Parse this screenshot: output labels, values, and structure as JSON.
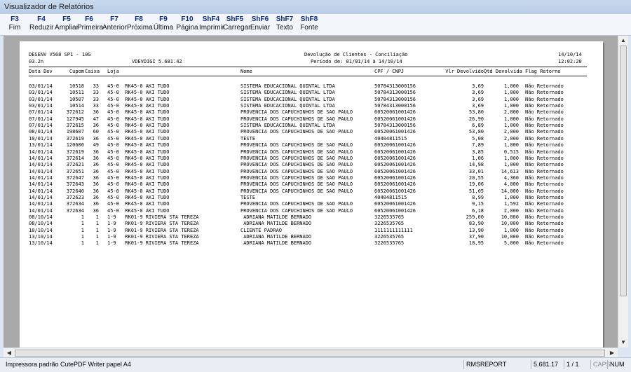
{
  "window": {
    "title": "Visualizador de Relatórios"
  },
  "toolbar": [
    {
      "key": "F3",
      "label": "Fim"
    },
    {
      "key": "F4",
      "label": "Reduzir"
    },
    {
      "key": "F5",
      "label": "Ampliar"
    },
    {
      "key": "F6",
      "label": "Primeira"
    },
    {
      "key": "F7",
      "label": "Anterior"
    },
    {
      "key": "F8",
      "label": "Próxima"
    },
    {
      "key": "F9",
      "label": "Última"
    },
    {
      "key": "F10",
      "label": "Página"
    },
    {
      "key": "ShF4",
      "label": "Imprimir"
    },
    {
      "key": "ShF5",
      "label": "Carregar"
    },
    {
      "key": "ShF6",
      "label": "Enviar"
    },
    {
      "key": "ShF7",
      "label": "Texto"
    },
    {
      "key": "ShF8",
      "label": "Fonte"
    }
  ],
  "report": {
    "system": "DESENV V568 SP1 - 10G",
    "version": "03.2n",
    "program": "VDEVDIGI 5.681.42",
    "title": "Devolução de Clientes - Conciliação",
    "period": "Período de: 01/01/14 à 14/10/14",
    "date": "14/10/14",
    "time": "12:02:20",
    "columns": [
      "Data Dev",
      "Cupom",
      "Caixa",
      "Loja",
      "Nome",
      "CPF / CNPJ",
      "Vlr Devolvido",
      "Qtd Devolvida",
      "Flag Retorno"
    ],
    "rows": [
      [
        "03/01/14",
        "10518",
        "33",
        "45-0  RK45-0 AKI TUDO",
        "SISTEMA EDUCACIONAL QUINTAL LTDA",
        "50784313000156",
        "3,69",
        "1,000",
        "Não Retornado"
      ],
      [
        "03/01/14",
        "10511",
        "33",
        "45-0  RK45-0 AKI TUDO",
        "SISTEMA EDUCACIONAL QUINTAL LTDA",
        "50784313000156",
        "3,69",
        "1,000",
        "Não Retornado"
      ],
      [
        "03/01/14",
        "10507",
        "33",
        "45-0  RK45-0 AKI TUDO",
        "SISTEMA EDUCACIONAL QUINTAL LTDA",
        "50784313000156",
        "3,69",
        "1,000",
        "Não Retornado"
      ],
      [
        "03/01/14",
        "10514",
        "33",
        "45-0  RK45-0 AKI TUDO",
        "SISTEMA EDUCACIONAL QUINTAL LTDA",
        "50784313000156",
        "3,69",
        "1,000",
        "Não Retornado"
      ],
      [
        "07/01/14",
        "372612",
        "36",
        "45-0  RK45-0 AKI TUDO",
        "PROVENCIA DOS CAPUCHINHOS DE SAO PAULO",
        "60520061001426",
        "53,80",
        "2,000",
        "Não Retornado"
      ],
      [
        "07/01/14",
        "127945",
        "47",
        "45-0  RK45-0 AKI TUDO",
        "PROVENCIA DOS CAPUCHINHOS DE SAO PAULO",
        "60520061001426",
        "26,90",
        "1,000",
        "Não Retornado"
      ],
      [
        "07/01/14",
        "372615",
        "36",
        "45-0  RK45-0 AKI TUDO",
        "SISTEMA EDUCACIONAL QUINTAL LTDA",
        "50784313000156",
        "6,89",
        "1,000",
        "Não Retornado"
      ],
      [
        "08/01/14",
        "198607",
        "60",
        "45-0  RK45-0 AKI TUDO",
        "PROVENCIA DOS CAPUCHINHOS DE SAO PAULO",
        "60520061001426",
        "53,80",
        "2,000",
        "Não Retornado"
      ],
      [
        "10/01/14",
        "372619",
        "36",
        "45-0  RK45-0 AKI TUDO",
        "TESTE",
        "40404811515",
        "5,08",
        "2,000",
        "Não Retornado"
      ],
      [
        "13/01/14",
        "120606",
        "49",
        "45-0  RK45-0 AKI TUDO",
        "PROVENCIA DOS CAPUCHINHOS DE SAO PAULO",
        "60520061001426",
        "7,89",
        "1,000",
        "Não Retornado"
      ],
      [
        "14/01/14",
        "372619",
        "36",
        "45-0  RK45-0 AKI TUDO",
        "PROVENCIA DOS CAPUCHINHOS DE SAO PAULO",
        "60520061001426",
        "3,85",
        "0,515",
        "Não Retornado"
      ],
      [
        "14/01/14",
        "372614",
        "36",
        "45-0  RK45-0 AKI TUDO",
        "PROVENCIA DOS CAPUCHINHOS DE SAO PAULO",
        "60520061001426",
        "1,06",
        "1,000",
        "Não Retornado"
      ],
      [
        "14/01/14",
        "372621",
        "36",
        "45-0  RK45-0 AKI TUDO",
        "PROVENCIA DOS CAPUCHINHOS DE SAO PAULO",
        "60520061001426",
        "14,98",
        "1,000",
        "Não Retornado"
      ],
      [
        "14/01/14",
        "372651",
        "36",
        "45-0  RK45-0 AKI TUDO",
        "PROVENCIA DOS CAPUCHINHOS DE SAO PAULO",
        "60520061001426",
        "33,01",
        "14,613",
        "Não Retornado"
      ],
      [
        "14/01/14",
        "372647",
        "36",
        "45-0  RK45-0 AKI TUDO",
        "PROVENCIA DOS CAPUCHINHOS DE SAO PAULO",
        "60520061001426",
        "20,55",
        "4,360",
        "Não Retornado"
      ],
      [
        "14/01/14",
        "372643",
        "36",
        "45-0  RK45-0 AKI TUDO",
        "PROVENCIA DOS CAPUCHINHOS DE SAO PAULO",
        "60520061001426",
        "19,06",
        "4,000",
        "Não Retornado"
      ],
      [
        "14/01/14",
        "372640",
        "36",
        "45-0  RK45-0 AKI TUDO",
        "PROVENCIA DOS CAPUCHINHOS DE SAO PAULO",
        "60520061001426",
        "51,05",
        "14,000",
        "Não Retornado"
      ],
      [
        "14/01/14",
        "372623",
        "36",
        "45-0  RK45-0 AKI TUDO",
        "TESTE",
        "40404811515",
        "8,99",
        "1,000",
        "Não Retornado"
      ],
      [
        "14/01/14",
        "372634",
        "36",
        "45-0  RK45-0 AKI TUDO",
        "PROVENCIA DOS CAPUCHINHOS DE SAO PAULO",
        "60520061001426",
        "9,15",
        "1,592",
        "Não Retornado"
      ],
      [
        "14/01/14",
        "372634",
        "36",
        "45-0  RK45-0 AKI TUDO",
        "PROVENCIA DOS CAPUCHINHOS DE SAO PAULO",
        "60520061001426",
        "6,18",
        "2,000",
        "Não Retornado"
      ],
      [
        "08/10/14",
        "1",
        "1",
        "1-9   RK01-9 RIVIERA STA TEREZA",
        " ADRIANA MATILDE BERNADO",
        "3226535765",
        "259,00",
        "10,000",
        "Não Retornado"
      ],
      [
        "08/10/14",
        "1",
        "1",
        "1-9   RK01-9 RIVIERA STA TEREZA",
        " ADRIANA MATILDE BERNADO",
        "3226535765",
        "83,90",
        "10,000",
        "Não Retornado"
      ],
      [
        "10/10/14",
        "1",
        "1",
        "1-9   RK01-9 RIVIERA STA TEREZA",
        "CLIENTE PADRAO",
        "1111111111111",
        "13,90",
        "1,000",
        "Não Retornado"
      ],
      [
        "13/10/14",
        "1",
        "1",
        "1-9   RK01-9 RIVIERA STA TEREZA",
        " ADRIANA MATILDE BERNADO",
        "3226535765",
        "37,90",
        "10,000",
        "Não Retornado"
      ],
      [
        "13/10/14",
        "1",
        "1",
        "1-9   RK01-9 RIVIERA STA TEREZA",
        " ADRIANA MATILDE BERNADO",
        "3226535765",
        "18,95",
        "5,000",
        "Não Retornado"
      ]
    ]
  },
  "status": {
    "printer": "Impressora padrão CutePDF Writer papel A4",
    "module": "RMSREPORT",
    "version": "5.681.17",
    "page": "1 / 1",
    "caps": "CAPS",
    "num": "NUM"
  }
}
